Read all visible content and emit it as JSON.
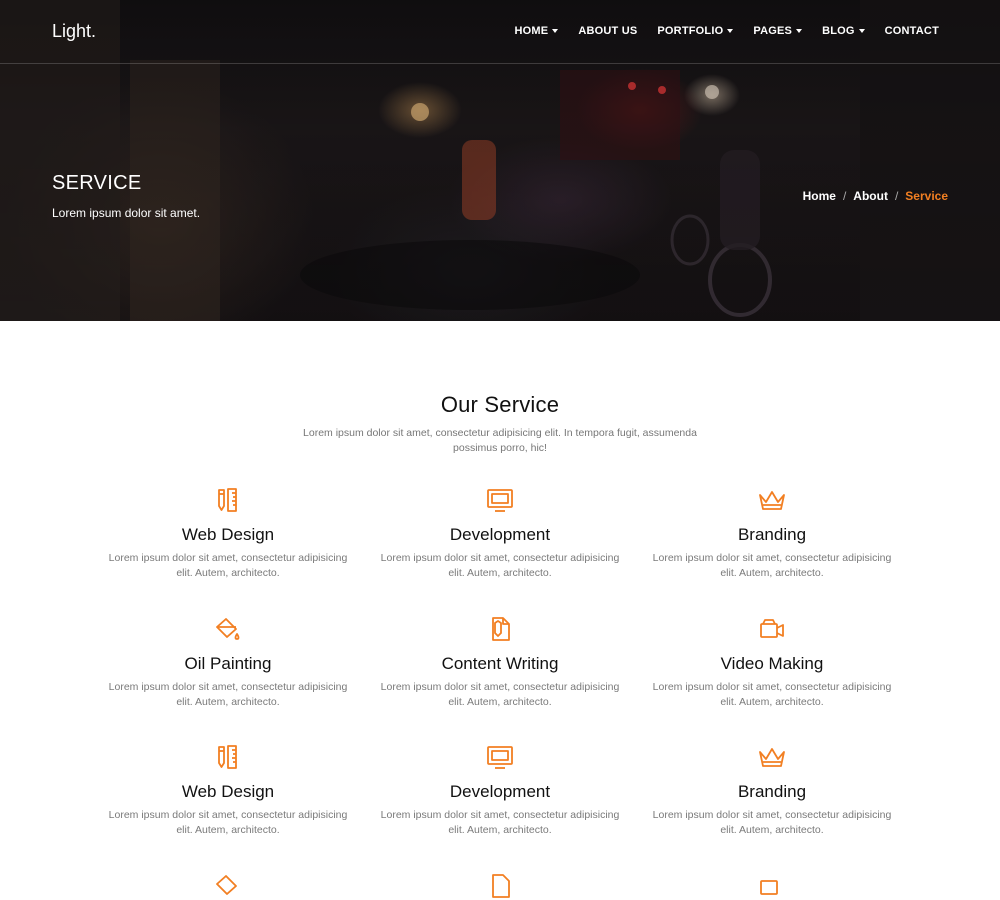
{
  "colors": {
    "accent": "#f27f22"
  },
  "nav": {
    "logo": "Light.",
    "items": [
      {
        "label": "HOME",
        "dropdown": true
      },
      {
        "label": "ABOUT US",
        "dropdown": false
      },
      {
        "label": "PORTFOLIO",
        "dropdown": true
      },
      {
        "label": "PAGES",
        "dropdown": true
      },
      {
        "label": "BLOG",
        "dropdown": true
      },
      {
        "label": "CONTACT",
        "dropdown": false
      }
    ]
  },
  "hero": {
    "title": "SERVICE",
    "subtitle": "Lorem ipsum dolor sit amet.",
    "breadcrumb": {
      "home": "Home",
      "about": "About",
      "current": "Service",
      "separator": "/"
    }
  },
  "services": {
    "title": "Our Service",
    "description": "Lorem ipsum dolor sit amet, consectetur adipisicing elit. In tempora fugit, assumenda possimus porro, hic!",
    "items": [
      {
        "title": "Web Design",
        "text": "Lorem ipsum dolor sit amet, consectetur adipisicing elit. Autem, architecto.",
        "icon": "pencil-ruler-icon"
      },
      {
        "title": "Development",
        "text": "Lorem ipsum dolor sit amet, consectetur adipisicing elit. Autem, architecto.",
        "icon": "monitor-icon"
      },
      {
        "title": "Branding",
        "text": "Lorem ipsum dolor sit amet, consectetur adipisicing elit. Autem, architecto.",
        "icon": "crown-icon"
      },
      {
        "title": "Oil Painting",
        "text": "Lorem ipsum dolor sit amet, consectetur adipisicing elit. Autem, architecto.",
        "icon": "paint-bucket-icon"
      },
      {
        "title": "Content Writing",
        "text": "Lorem ipsum dolor sit amet, consectetur adipisicing elit. Autem, architecto.",
        "icon": "document-pen-icon"
      },
      {
        "title": "Video Making",
        "text": "Lorem ipsum dolor sit amet, consectetur adipisicing elit. Autem, architecto.",
        "icon": "video-camera-icon"
      },
      {
        "title": "Web Design",
        "text": "Lorem ipsum dolor sit amet, consectetur adipisicing elit. Autem, architecto.",
        "icon": "pencil-ruler-icon"
      },
      {
        "title": "Development",
        "text": "Lorem ipsum dolor sit amet, consectetur adipisicing elit. Autem, architecto.",
        "icon": "monitor-icon"
      },
      {
        "title": "Branding",
        "text": "Lorem ipsum dolor sit amet, consectetur adipisicing elit. Autem, architecto.",
        "icon": "crown-icon"
      }
    ]
  }
}
